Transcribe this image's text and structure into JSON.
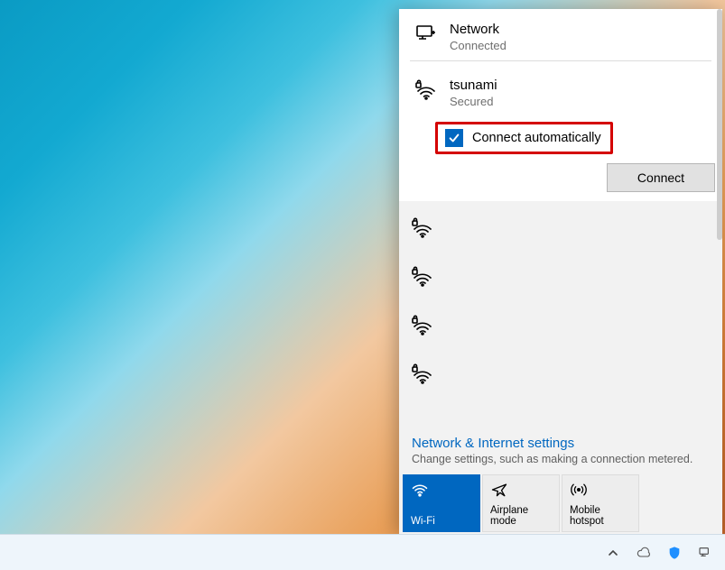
{
  "header": {
    "title": "Network",
    "status": "Connected"
  },
  "selected_network": {
    "ssid": "tsunami",
    "security": "Secured",
    "connect_automatically_label": "Connect automatically",
    "connect_automatically_checked": true,
    "connect_button": "Connect"
  },
  "other_networks_count": 4,
  "settings": {
    "link": "Network & Internet settings",
    "description": "Change settings, such as making a connection metered."
  },
  "tiles": [
    {
      "id": "wifi",
      "label": "Wi-Fi",
      "active": true
    },
    {
      "id": "airplane",
      "label": "Airplane mode",
      "active": false
    },
    {
      "id": "hotspot",
      "label": "Mobile hotspot",
      "active": false
    }
  ],
  "tray": {
    "items": [
      "chevron-up",
      "cloud",
      "security-shield",
      "network"
    ]
  },
  "annotation": {
    "highlight_connect_automatically": true,
    "highlight_color": "#d40000"
  }
}
